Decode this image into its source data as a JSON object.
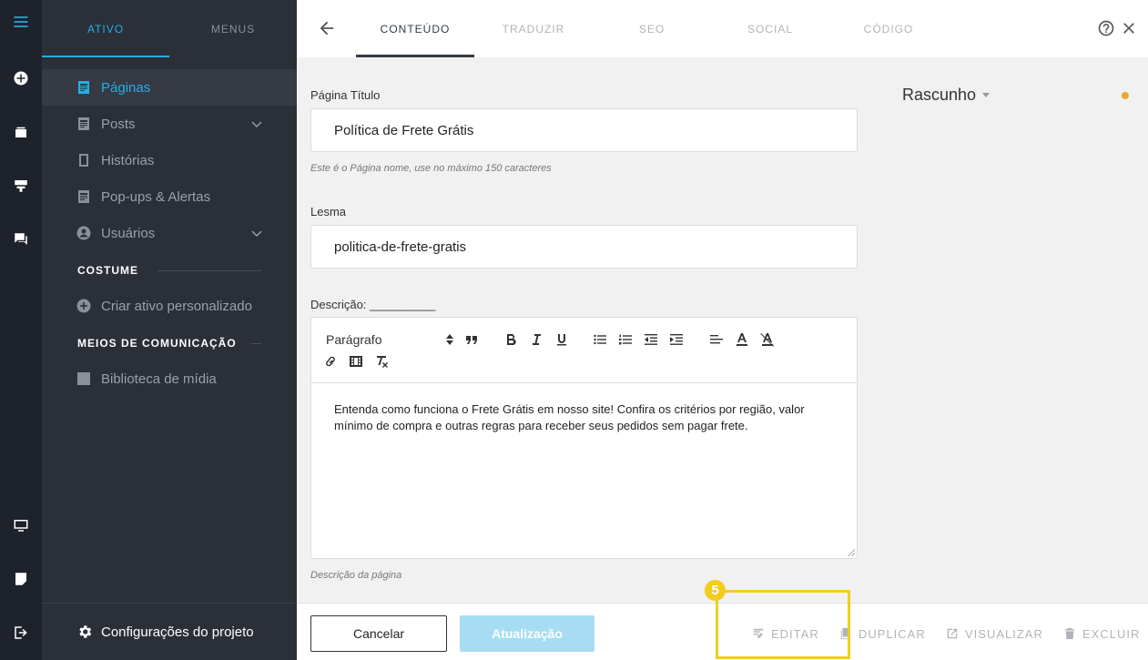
{
  "sidebar": {
    "tabs": [
      {
        "label": "ATIVO"
      },
      {
        "label": "MENUS"
      }
    ],
    "items": [
      {
        "label": "Páginas",
        "icon": "page-icon"
      },
      {
        "label": "Posts",
        "icon": "post-icon"
      },
      {
        "label": "Histórias",
        "icon": "story-icon"
      },
      {
        "label": "Pop-ups & Alertas",
        "icon": "popup-icon"
      },
      {
        "label": "Usuários",
        "icon": "user-icon"
      }
    ],
    "section_custom": "COSTUME",
    "create_custom": "Criar ativo personalizado",
    "section_media": "MEIOS DE COMUNICAÇÃO",
    "media_library": "Biblioteca de mídia",
    "settings": "Configurações do projeto"
  },
  "header": {
    "tabs": [
      {
        "label": "CONTEÚDO"
      },
      {
        "label": "TRADUZIR"
      },
      {
        "label": "SEO"
      },
      {
        "label": "SOCIAL"
      },
      {
        "label": "CÓDIGO"
      }
    ]
  },
  "form": {
    "title_label": "Página Título",
    "title_value": "Política de Frete Grátis",
    "title_hint": "Este é o Página nome, use no máximo 150 caracteres",
    "slug_label": "Lesma",
    "slug_value": "politica-de-frete-gratis",
    "description_label": "Descrição: __________",
    "paragraph_select": "Parágrafo",
    "description_text": "Entenda como funciona o Frete Grátis em nosso site! Confira os critérios por região, valor mínimo de compra e outras regras para receber seus pedidos sem pagar frete.",
    "description_hint": "Descrição da página"
  },
  "status": {
    "label": "Rascunho",
    "dot_color": "#e8a82a"
  },
  "footer": {
    "cancel": "Cancelar",
    "update": "Atualização",
    "edit": "EDITAR",
    "duplicate": "DUPLICAR",
    "view": "VISUALIZAR",
    "delete": "EXCLUIR"
  },
  "annotation": {
    "badge": "5"
  },
  "colors": {
    "accent": "#29aee6",
    "highlight": "#f2cd1c"
  }
}
